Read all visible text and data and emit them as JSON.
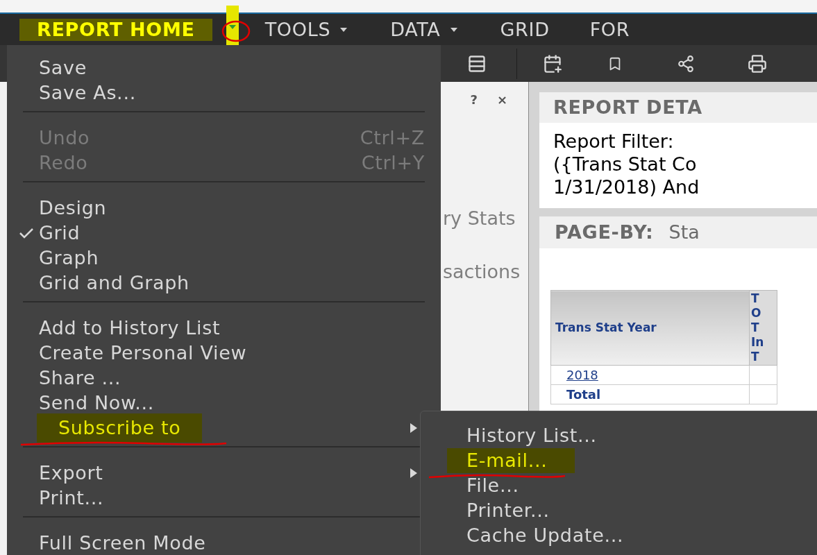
{
  "nav": [
    {
      "label": "REPORT HOME",
      "caret": true,
      "annotated": true
    },
    {
      "label": "TOOLS",
      "caret": true,
      "annotated": false
    },
    {
      "label": "DATA",
      "caret": true,
      "annotated": false
    },
    {
      "label": "GRID",
      "caret": false,
      "annotated": false
    },
    {
      "label": "FOR",
      "caret": false,
      "annotated": false
    }
  ],
  "menu": {
    "groups": [
      [
        {
          "label": "Save",
          "disabled": false,
          "checked": false,
          "submenu": false,
          "annotated": false
        },
        {
          "label": "Save As...",
          "disabled": false,
          "checked": false,
          "submenu": false,
          "annotated": false
        }
      ],
      [
        {
          "label": "Undo",
          "shortcut": "Ctrl+Z",
          "disabled": true,
          "checked": false,
          "submenu": false,
          "annotated": false
        },
        {
          "label": "Redo",
          "shortcut": "Ctrl+Y",
          "disabled": true,
          "checked": false,
          "submenu": false,
          "annotated": false
        }
      ],
      [
        {
          "label": "Design",
          "disabled": false,
          "checked": false,
          "submenu": false,
          "annotated": false
        },
        {
          "label": "Grid",
          "disabled": false,
          "checked": true,
          "submenu": false,
          "annotated": false
        },
        {
          "label": "Graph",
          "disabled": false,
          "checked": false,
          "submenu": false,
          "annotated": false
        },
        {
          "label": "Grid and Graph",
          "disabled": false,
          "checked": false,
          "submenu": false,
          "annotated": false
        }
      ],
      [
        {
          "label": "Add to History List",
          "disabled": false,
          "checked": false,
          "submenu": false,
          "annotated": false
        },
        {
          "label": "Create Personal View",
          "disabled": false,
          "checked": false,
          "submenu": false,
          "annotated": false
        },
        {
          "label": "Share ...",
          "disabled": false,
          "checked": false,
          "submenu": false,
          "annotated": false
        },
        {
          "label": "Send Now...",
          "disabled": false,
          "checked": false,
          "submenu": false,
          "annotated": false
        },
        {
          "label": "Subscribe to",
          "disabled": false,
          "checked": false,
          "submenu": true,
          "annotated": true
        }
      ],
      [
        {
          "label": "Export",
          "disabled": false,
          "checked": false,
          "submenu": true,
          "annotated": false
        },
        {
          "label": "Print...",
          "disabled": false,
          "checked": false,
          "submenu": false,
          "annotated": false
        }
      ],
      [
        {
          "label": "Full Screen Mode",
          "disabled": false,
          "checked": false,
          "submenu": false,
          "annotated": false
        }
      ]
    ]
  },
  "submenu": [
    {
      "label": "History List...",
      "annotated": false
    },
    {
      "label": "E-mail...",
      "annotated": true
    },
    {
      "label": "File...",
      "annotated": false
    },
    {
      "label": "Printer...",
      "annotated": false
    },
    {
      "label": "Cache Update...",
      "annotated": false
    }
  ],
  "panel": {
    "help": "?",
    "close": "×",
    "items": [
      "ry Stats",
      "sactions"
    ]
  },
  "report_details": {
    "title": "REPORT DETA",
    "lines": [
      "Report Filter:",
      "({Trans Stat Co",
      "1/31/2018) And"
    ]
  },
  "page_by": {
    "label": "PAGE-BY:",
    "value": "Sta"
  },
  "table": {
    "columns": [
      {
        "label": "Trans Stat Year"
      },
      {
        "lines": [
          "T",
          "O",
          "T",
          "In",
          "T"
        ]
      }
    ],
    "rows": [
      {
        "cell": "2018",
        "link": true
      },
      {
        "cell": "Total",
        "link": false
      }
    ]
  }
}
